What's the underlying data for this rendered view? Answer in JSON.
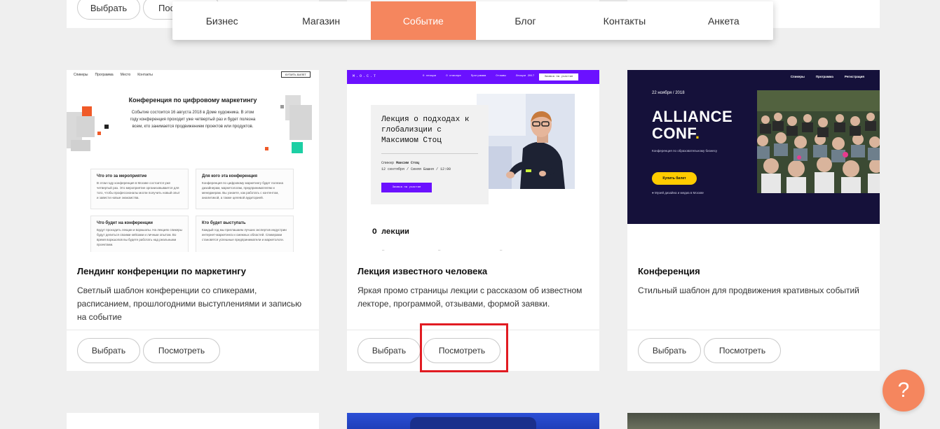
{
  "top_partial": {
    "choose_label": "Выбрать",
    "view_label": "Пос"
  },
  "categories": [
    {
      "label": "Бизнес",
      "active": false
    },
    {
      "label": "Магазин",
      "active": false
    },
    {
      "label": "Событие",
      "active": true
    },
    {
      "label": "Блог",
      "active": false
    },
    {
      "label": "Контакты",
      "active": false
    },
    {
      "label": "Анкета",
      "active": false
    }
  ],
  "cards": [
    {
      "title": "Лендинг конференции по маркетингу",
      "description": "Светлый шаблон конференции со спикерами, расписанием, прошлогодними выступлениями и записью на событие",
      "choose_label": "Выбрать",
      "view_label": "Посмотреть",
      "preview": {
        "nav": [
          "Спикеры",
          "Программа",
          "Место",
          "Контакты"
        ],
        "nav_button": "КУПИТЬ БИЛЕТ",
        "heading": "Конференция по цифровому маркетингу",
        "intro": "Событие состоится 16 августа 2018 в Доме художника. В этом году конференция проходит уже четвертый раз и будет полезна всем, кто занимается продвижением проектов или продуктов.",
        "boxes": [
          {
            "title": "Что это за мероприятие",
            "text": "В этом году конференция в Москве состоится уже четвертый раз. Это мероприятие организовывается для того, чтобы профессионалы могли получить новый опыт и завести новые знакомства."
          },
          {
            "title": "Для кого эта конференция",
            "text": "Конференция по цифровому маркетингу будет полезна дизайнерам, маркетологам, предпринимателям и менеджерам. Вы узнаете, как работать с контентом, аналитикой, а также целевой аудиторией."
          },
          {
            "title": "Что будет на конференции",
            "text": "Будут проходить лекции и воркшопы. На лекциях спикеры будут делиться своими кейсами и личным опытом. Во время воркшопов вы будете работать над реальными проектами."
          },
          {
            "title": "Кто будет выступать",
            "text": "Каждый год мы приглашаем лучших экспертов индустрии интернет-маркетинга и смежных областей. Спикерами становятся успешные предприниматели и маркетологи."
          }
        ]
      }
    },
    {
      "title": "Лекция известного человека",
      "description": "Яркая промо страницы лекции с рассказом об известном лекторе, программой, отзывами, формой заявки.",
      "choose_label": "Выбрать",
      "view_label": "Посмотреть",
      "preview": {
        "logo": "М.О.С.Т",
        "nav": [
          "О лекции",
          "О спикере",
          "Программа",
          "Отзывы",
          "Лекции 2017"
        ],
        "nav_button": "Заявка на участие",
        "lecture_title": "Лекция о подходах к глобализции с Максимом Стоц",
        "speaker_prefix": "Спикер",
        "speaker_name": "Максим Стоц",
        "when_where": "12 сентября / Синяя Башня / 12:00",
        "panel_button": "Заявка на участие",
        "about_heading": "О лекции"
      }
    },
    {
      "title": "Конференция",
      "description": "Стильный шаблон для продвижения кративных событий",
      "choose_label": "Выбрать",
      "view_label": "Посмотреть",
      "preview": {
        "nav": [
          "Спикеры",
          "Программа",
          "Регистрация"
        ],
        "date": "22 ноября / 2018",
        "headline_line1": "ALLIANCE",
        "headline_line2": "CONF",
        "headline_dot": ".",
        "subtitle": "Конференция по образовательному бизнесу",
        "button": "Купить билет",
        "place": "Музей дизайна и медиа в Москве"
      }
    }
  ],
  "help_button": "?",
  "colors": {
    "accent": "#f5865e",
    "purple": "#6b11ff",
    "navy": "#15113a",
    "yellow": "#ffcc00",
    "highlight": "#e11b22"
  }
}
